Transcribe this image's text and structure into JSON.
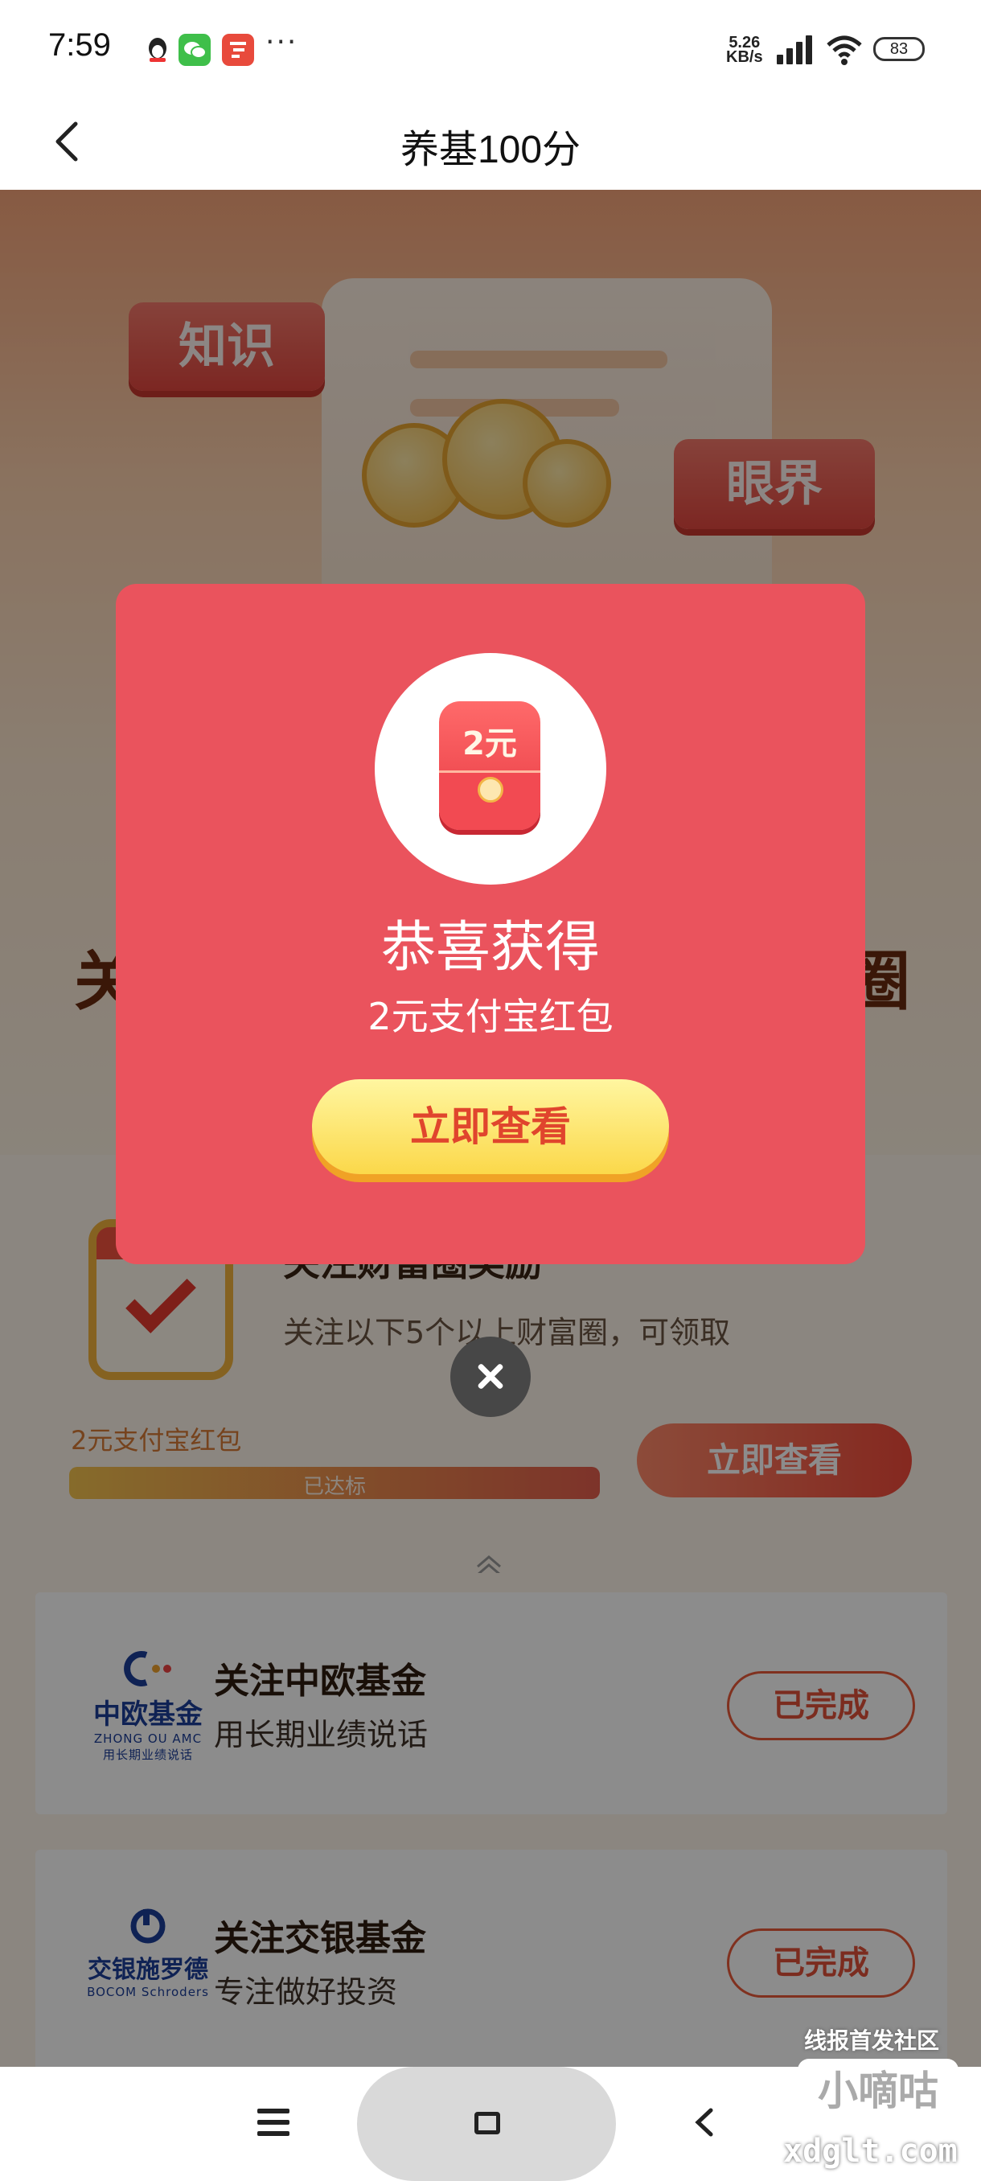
{
  "status_bar": {
    "time": "7:59",
    "dots": "···",
    "net_speed_value": "5.26",
    "net_speed_unit": "KB/s",
    "battery": "83"
  },
  "nav": {
    "title": "养基100分"
  },
  "banner": {
    "bubble_1": "知识",
    "bubble_2": "眼界",
    "headline_left": "关",
    "headline_right": "圈"
  },
  "task": {
    "title": "关注财富圈奖励",
    "description": "关注以下5个以上财富圈，可领取",
    "prize": "2元支付宝红包",
    "progress_label": "已达标",
    "progress_fraction": 1.0,
    "button_label": "立即查看"
  },
  "funds": [
    {
      "logo_name": "中欧基金",
      "logo_sub": "ZHONG OU AMC",
      "logo_tagline": "用长期业绩说话",
      "name": "关注中欧基金",
      "slogan": "用长期业绩说话",
      "button_label": "已完成"
    },
    {
      "logo_name": "交银施罗德",
      "logo_sub": "BOCOM Schroders",
      "name": "关注交银基金",
      "slogan": "专注做好投资",
      "button_label": "已完成"
    }
  ],
  "modal": {
    "packet_amount": "2元",
    "title": "恭喜获得",
    "subtitle": "2元支付宝红包",
    "button_label": "立即查看"
  },
  "watermark": {
    "top": "线报首发社区",
    "middle": "小嘀咕",
    "bottom": "xdglt.com"
  },
  "colors": {
    "modal_bg": "#ea535d",
    "modal_button": "#fbd84a",
    "accent_red": "#e0503a"
  },
  "icons": [
    "back-icon",
    "signal-icon",
    "wifi-icon",
    "battery-icon",
    "close-icon",
    "chevron-up-icon",
    "menu-icon",
    "home-icon",
    "nav-back-icon",
    "red-packet-icon",
    "calendar-check-icon"
  ]
}
